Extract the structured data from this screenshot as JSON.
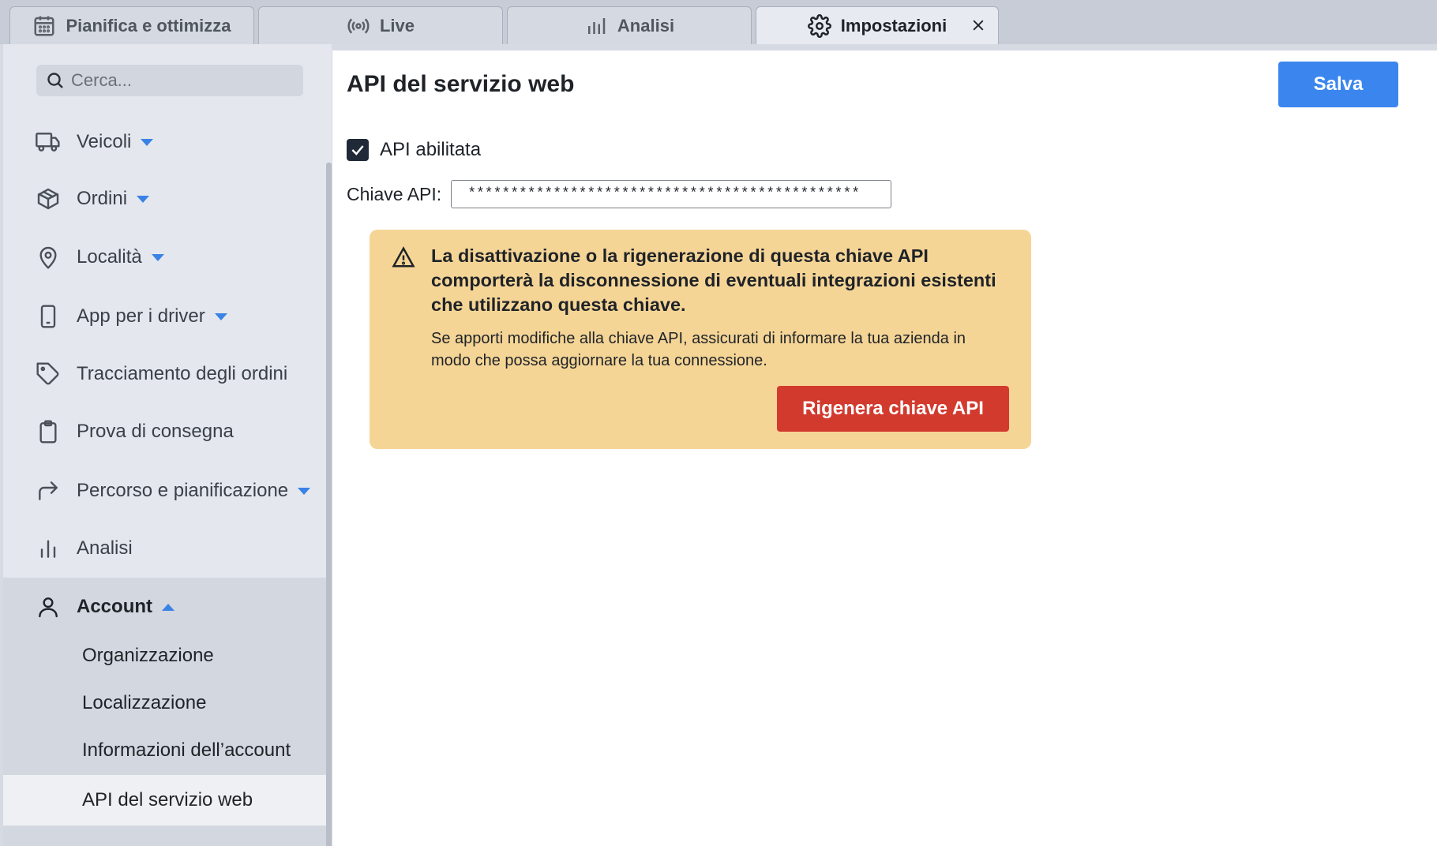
{
  "tabs": [
    {
      "label": "Pianifica e ottimizza",
      "icon": "calendar-icon"
    },
    {
      "label": "Live",
      "icon": "broadcast-icon"
    },
    {
      "label": "Analisi",
      "icon": "bar-chart-icon"
    },
    {
      "label": "Impostazioni",
      "icon": "gear-icon",
      "active": true
    }
  ],
  "search": {
    "placeholder": "Cerca..."
  },
  "sidebar": {
    "items": [
      {
        "label": "Veicoli",
        "icon": "truck-icon",
        "caret": "down"
      },
      {
        "label": "Ordini",
        "icon": "box-icon",
        "caret": "down"
      },
      {
        "label": "Località",
        "icon": "map-pin-icon",
        "caret": "down"
      },
      {
        "label": "App per i driver",
        "icon": "smartphone-icon",
        "caret": "down"
      },
      {
        "label": "Tracciamento degli ordini",
        "icon": "tag-icon"
      },
      {
        "label": "Prova di consegna",
        "icon": "clipboard-icon"
      },
      {
        "label": "Percorso e pianificazione",
        "icon": "route-arrow-icon",
        "caret": "down"
      },
      {
        "label": "Analisi",
        "icon": "bar-chart-icon"
      },
      {
        "label": "Account",
        "icon": "user-icon",
        "caret": "up",
        "expanded": true
      }
    ],
    "account_sub": [
      {
        "label": "Organizzazione"
      },
      {
        "label": "Localizzazione"
      },
      {
        "label": "Informazioni dell’account"
      },
      {
        "label": "API del servizio web",
        "active": true
      }
    ]
  },
  "main": {
    "title": "API del servizio web",
    "save_label": "Salva",
    "api_enabled_label": "API abilitata",
    "api_enabled": true,
    "key_label": "Chiave API:",
    "key_value": "**********************************************",
    "warning": {
      "title": "La disattivazione o la rigenerazione di questa chiave API comporterà la disconnessione di eventuali integrazioni esistenti che utilizzano questa chiave.",
      "body": "Se apporti modifiche alla chiave API, assicurati di informare la tua azienda in modo che possa aggiornare la tua connessione.",
      "button_label": "Rigenera chiave API"
    }
  },
  "colors": {
    "primary": "#3b86ee",
    "danger": "#d23a2e",
    "warning_bg": "#f5d596",
    "caret": "#3b82e6"
  }
}
